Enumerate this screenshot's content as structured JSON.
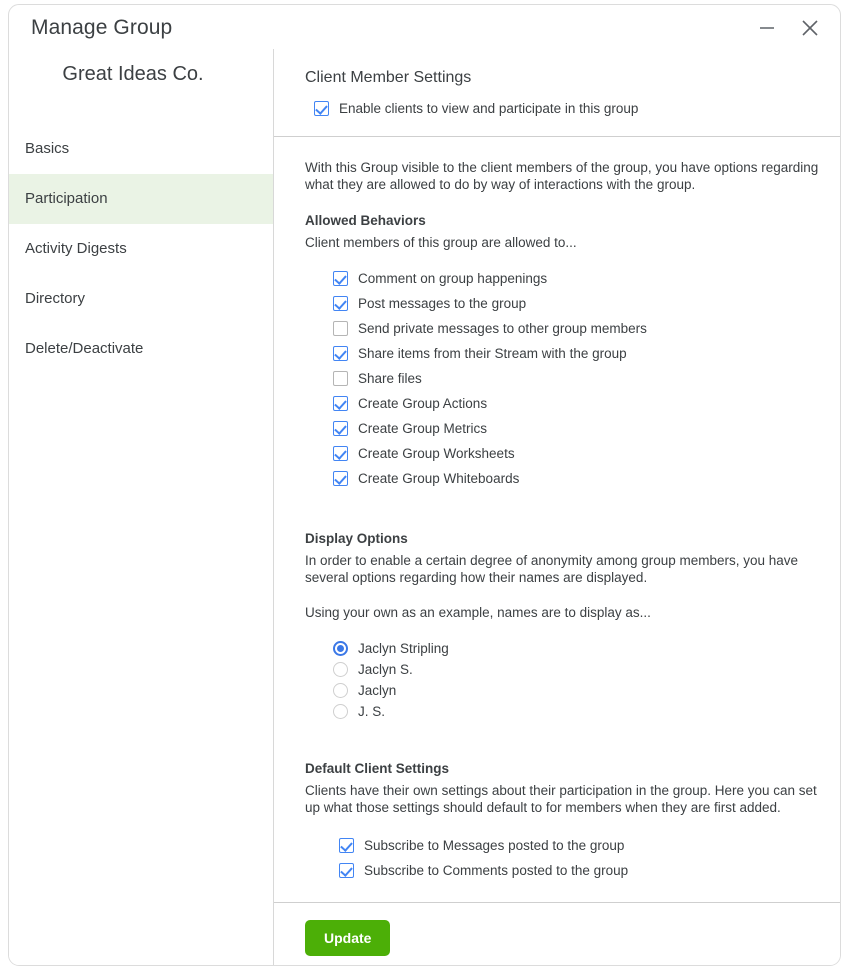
{
  "window": {
    "title": "Manage Group",
    "minimize_icon": "minimize-icon",
    "close_icon": "close-icon"
  },
  "sidebar": {
    "org_name": "Great Ideas Co.",
    "items": [
      {
        "label": "Basics",
        "active": false
      },
      {
        "label": "Participation",
        "active": true
      },
      {
        "label": "Activity Digests",
        "active": false
      },
      {
        "label": "Directory",
        "active": false
      },
      {
        "label": "Delete/Deactivate",
        "active": false
      }
    ]
  },
  "content": {
    "client_member_settings": {
      "title": "Client Member Settings",
      "enable_checkbox": {
        "label": "Enable clients to view and participate in this group",
        "checked": true
      }
    },
    "intro_paragraph": "With this Group visible to the client members of the group, you have options regarding what they are allowed to do by way of interactions with the group.",
    "allowed_behaviors": {
      "heading": "Allowed Behaviors",
      "subtext": "Client members of this group are allowed to...",
      "options": [
        {
          "label": "Comment on group happenings",
          "checked": true
        },
        {
          "label": "Post messages to the group",
          "checked": true
        },
        {
          "label": "Send private messages to other group members",
          "checked": false
        },
        {
          "label": "Share items from their Stream with the group",
          "checked": true
        },
        {
          "label": "Share files",
          "checked": false
        },
        {
          "label": "Create Group Actions",
          "checked": true
        },
        {
          "label": "Create Group Metrics",
          "checked": true
        },
        {
          "label": "Create Group Worksheets",
          "checked": true
        },
        {
          "label": "Create Group Whiteboards",
          "checked": true
        }
      ]
    },
    "display_options": {
      "heading": "Display Options",
      "description": "In order to enable a certain degree of anonymity among group members, you have several options regarding how their names are displayed.",
      "prompt": "Using your own as an example, names are to display as...",
      "options": [
        {
          "label": "Jaclyn Stripling",
          "selected": true
        },
        {
          "label": "Jaclyn S.",
          "selected": false
        },
        {
          "label": "Jaclyn",
          "selected": false
        },
        {
          "label": "J. S.",
          "selected": false
        }
      ]
    },
    "default_client_settings": {
      "heading": "Default Client Settings",
      "description": "Clients have their own settings about their participation in the group. Here you can set up what those settings should default to for members when they are first added.",
      "options": [
        {
          "label": "Subscribe to Messages posted to the group",
          "checked": true
        },
        {
          "label": "Subscribe to Comments posted to the group",
          "checked": true
        }
      ]
    },
    "update_button": "Update"
  },
  "colors": {
    "accent_blue": "#4285f4",
    "active_nav_bg": "#eaf3e5",
    "update_green": "#4caf07"
  }
}
